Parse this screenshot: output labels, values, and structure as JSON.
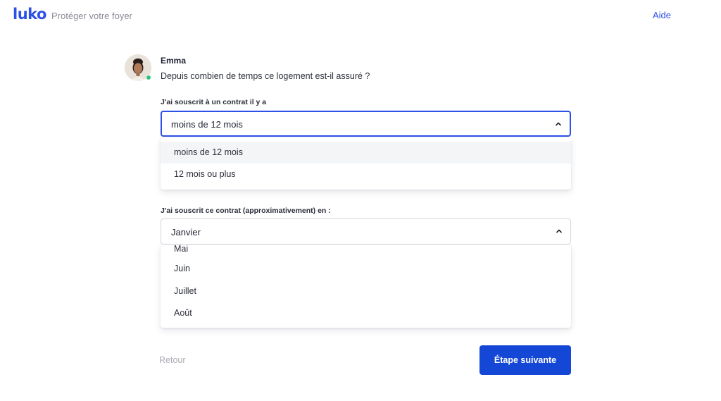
{
  "header": {
    "logo": "luko",
    "tagline": "Protéger votre foyer",
    "help_label": "Aide"
  },
  "agent": {
    "name": "Emma",
    "status": "online",
    "question": "Depuis combien de temps ce logement est-il assuré ?"
  },
  "contract_age": {
    "label": "J'ai souscrit à un contrat il y a",
    "selected": "moins de 12 mois",
    "options": [
      "moins de 12 mois",
      "12 mois ou plus"
    ]
  },
  "contract_month": {
    "label": "J'ai souscrit ce contrat (approximativement) en :",
    "selected": "Janvier",
    "visible_options": [
      "Mai",
      "Juin",
      "Juillet",
      "Août"
    ]
  },
  "footer": {
    "back_label": "Retour",
    "next_label": "Étape suivante"
  },
  "colors": {
    "brand": "#2d50e6",
    "primary_button": "#1447d6",
    "online": "#2ec27e"
  },
  "icons": {
    "dropdown_toggle": "chevron-up-icon"
  }
}
